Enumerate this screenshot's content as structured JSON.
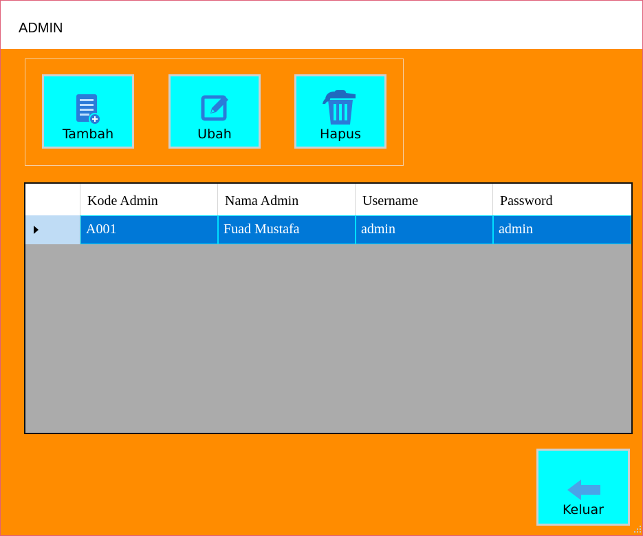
{
  "window": {
    "title": "ADMIN"
  },
  "toolbar": {
    "add_label": "Tambah",
    "edit_label": "Ubah",
    "delete_label": "Hapus"
  },
  "table": {
    "columns": [
      "Kode Admin",
      "Nama Admin",
      "Username",
      "Password"
    ],
    "rows": [
      {
        "kode": "A001",
        "nama": "Fuad Mustafa",
        "username": "admin",
        "password": "admin",
        "selected": true
      }
    ]
  },
  "footer": {
    "exit_label": "Keluar"
  },
  "colors": {
    "background": "#ff8c00",
    "button": "#00ffff",
    "selection": "#0078d7",
    "grid_empty": "#ababab"
  }
}
